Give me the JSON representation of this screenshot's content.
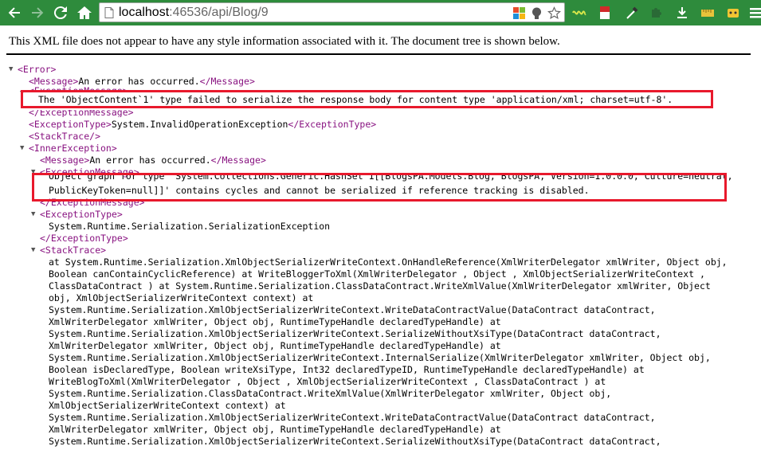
{
  "browser": {
    "url_host": "localhost",
    "url_rest": ":46536/api/Blog/9"
  },
  "viewer": {
    "notice": "This XML file does not appear to have any style information associated with it. The document tree is shown below."
  },
  "xml": {
    "error_open": "<Error>",
    "message_open": "<Message>",
    "message_text": "An error has occurred.",
    "message_close": "</Message>",
    "exmsg_open": "<ExceptionMessage>",
    "exmsg_text": "The 'ObjectContent`1' type failed to serialize the response body for content type 'application/xml; charset=utf-8'.",
    "exmsg_close": "</ExceptionMessage>",
    "extype_open": "<ExceptionType>",
    "extype_text": "System.InvalidOperationException",
    "extype_close": "</ExceptionType>",
    "stacktrace_empty": "<StackTrace/>",
    "inner_open": "<InnerException>",
    "inner_message_text": "An error has occurred.",
    "inner_exmsg_line1": "Object graph for type 'System.Collections.Generic.HashSet`1[[BlogsPA.Models.Blog, BlogsPA, Version=1.0.0.0, Culture=neutral,",
    "inner_exmsg_line2": "PublicKeyToken=null]]' contains cycles and cannot be serialized if reference tracking is disabled.",
    "inner_extype_text": "System.Runtime.Serialization.SerializationException",
    "stacktrace_open": "<StackTrace>",
    "stack_lines": [
      "at System.Runtime.Serialization.XmlObjectSerializerWriteContext.OnHandleReference(XmlWriterDelegator xmlWriter, Object obj,",
      "Boolean canContainCyclicReference) at WriteBloggerToXml(XmlWriterDelegator , Object , XmlObjectSerializerWriteContext ,",
      "ClassDataContract ) at System.Runtime.Serialization.ClassDataContract.WriteXmlValue(XmlWriterDelegator xmlWriter, Object",
      "obj, XmlObjectSerializerWriteContext context) at",
      "System.Runtime.Serialization.XmlObjectSerializerWriteContext.WriteDataContractValue(DataContract dataContract,",
      "XmlWriterDelegator xmlWriter, Object obj, RuntimeTypeHandle declaredTypeHandle) at",
      "System.Runtime.Serialization.XmlObjectSerializerWriteContext.SerializeWithoutXsiType(DataContract dataContract,",
      "XmlWriterDelegator xmlWriter, Object obj, RuntimeTypeHandle declaredTypeHandle) at",
      "System.Runtime.Serialization.XmlObjectSerializerWriteContext.InternalSerialize(XmlWriterDelegator xmlWriter, Object obj,",
      "Boolean isDeclaredType, Boolean writeXsiType, Int32 declaredTypeID, RuntimeTypeHandle declaredTypeHandle) at",
      "WriteBlogToXml(XmlWriterDelegator , Object , XmlObjectSerializerWriteContext , ClassDataContract ) at",
      "System.Runtime.Serialization.ClassDataContract.WriteXmlValue(XmlWriterDelegator xmlWriter, Object obj,",
      "XmlObjectSerializerWriteContext context) at",
      "System.Runtime.Serialization.XmlObjectSerializerWriteContext.WriteDataContractValue(DataContract dataContract,",
      "XmlWriterDelegator xmlWriter, Object obj, RuntimeTypeHandle declaredTypeHandle) at",
      "System.Runtime.Serialization.XmlObjectSerializerWriteContext.SerializeWithoutXsiType(DataContract dataContract,"
    ]
  },
  "colors": {
    "toolbar": "#2e8b3c",
    "tag": "#881280",
    "highlight": "#e8192c"
  },
  "icons": [
    "back-icon",
    "forward-icon",
    "reload-icon",
    "home-icon",
    "page-icon",
    "office-icon",
    "bulb-icon",
    "star-icon",
    "extension-icons",
    "menu-icon"
  ]
}
